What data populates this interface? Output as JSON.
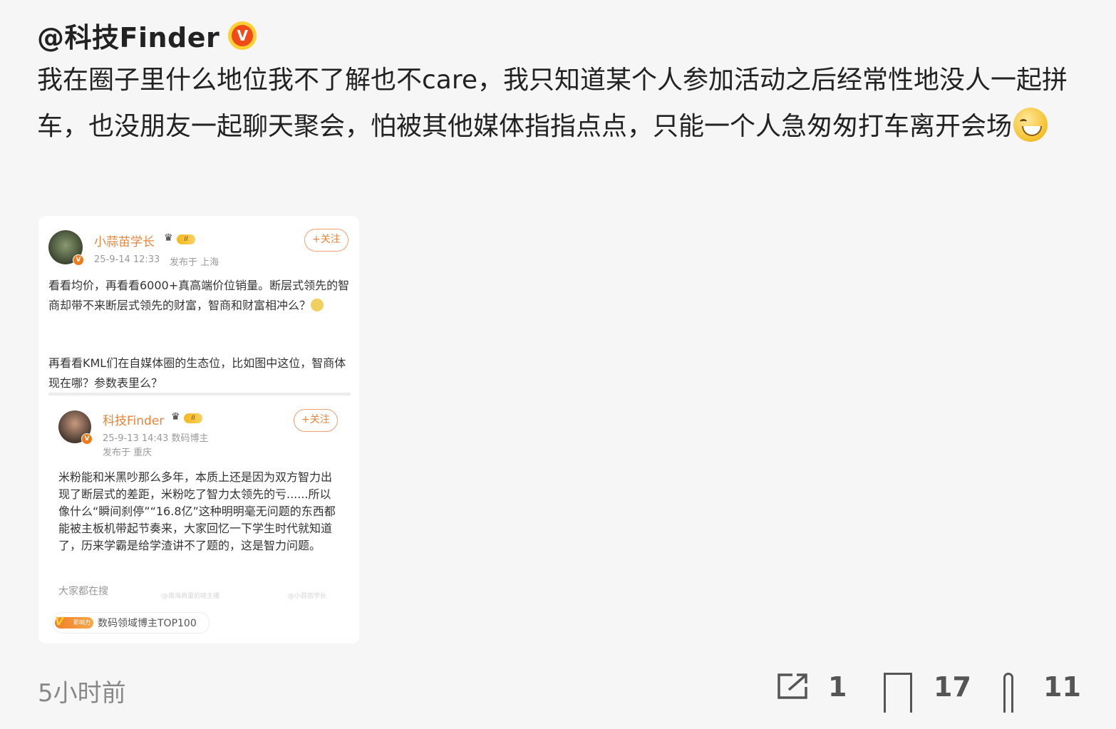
{
  "post": {
    "author": "@科技Finder",
    "verified_badge": "V",
    "text": "我在圈子里什么地位我不了解也不care，我只知道某个人参加活动之后经常性地没人一起拼车，也没朋友一起聊天聚会，怕被其他媒体指指点点，只能一个人急匆匆打车离开会场",
    "emoji": "grinning-smile-emoji",
    "timestamp": "5小时前",
    "actions": {
      "repost_count": "1",
      "comment_count": "17",
      "like_count": "11"
    }
  },
  "screenshot": {
    "main": {
      "name": "小蒜苗学长",
      "level": "II",
      "time": "25-9-14 12:33",
      "location": "发布于 上海",
      "follow": "+关注",
      "para1": "看看均价，再看看6000+真高端价位销量。断层式领先的智商却带不来断层式领先的财富，智商和财富相冲么？",
      "para2": "再看看KML们在自媒体圈的生态位，比如图中这位，智商体现在哪？参数表里么？"
    },
    "quoted": {
      "name": "科技Finder",
      "level": "II",
      "time_role": "25-9-13 14:43  数码博主",
      "location": "发布于 重庆",
      "follow": "+关注",
      "text": "米粉能和米黑吵那么多年，本质上还是因为双方智力出现了断层式的差距，米粉吃了智力太领先的亏......所以像什么“瞬间刹停”“16.8亿”这种明明毫无问题的东西都能被主板机带起节奏来，大家回忆一下学生时代就知道了，历来学霸是给学渣讲不了题的，这是智力问题。"
    },
    "search_label": "大家都在搜",
    "search_tags": [
      "@南海商量的晓主播",
      "@小蒜苗学长"
    ],
    "influence_label": "影响力",
    "top_label": "数码领域博主TOP100"
  },
  "icons": [
    "share-icon",
    "comment-icon",
    "like-icon"
  ],
  "colors": {
    "accent_orange": "#e8833a",
    "badge_yellow": "#ffcf33",
    "badge_red": "#f04a18",
    "bg": "#f6f6f6"
  }
}
